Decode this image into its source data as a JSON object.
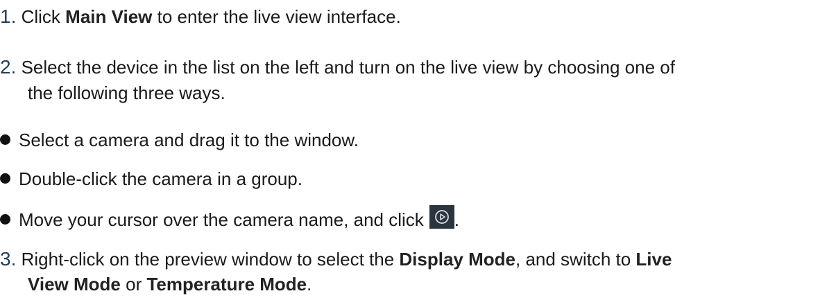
{
  "steps": [
    {
      "num": "1.",
      "pre": "Click ",
      "bold": "Main View",
      "post": " to enter the live view interface."
    },
    {
      "num": "2.",
      "line1": "Select the device in the list on the left and turn on the live view by choosing one of",
      "line2": "the following three ways."
    },
    {
      "num": "3.",
      "pre": "Right-click on the preview window to select the ",
      "bold1": "Display Mode",
      "mid": ", and switch to ",
      "bold2a": "Live",
      "bold2b": "View Mode",
      "mid2": " or ",
      "bold3": "Temperature Mode",
      "post": "."
    }
  ],
  "bullets": [
    "Select a camera and drag it to the window.",
    "Double-click the camera in a group.",
    "Move your cursor over the camera name, and click"
  ],
  "bullet3_suffix": ".",
  "icons": {
    "play": "play-circle-icon"
  },
  "colors": {
    "number": "#1f3f5c",
    "icon_bg": "#2b3540",
    "icon_fg": "#d8dde2"
  }
}
